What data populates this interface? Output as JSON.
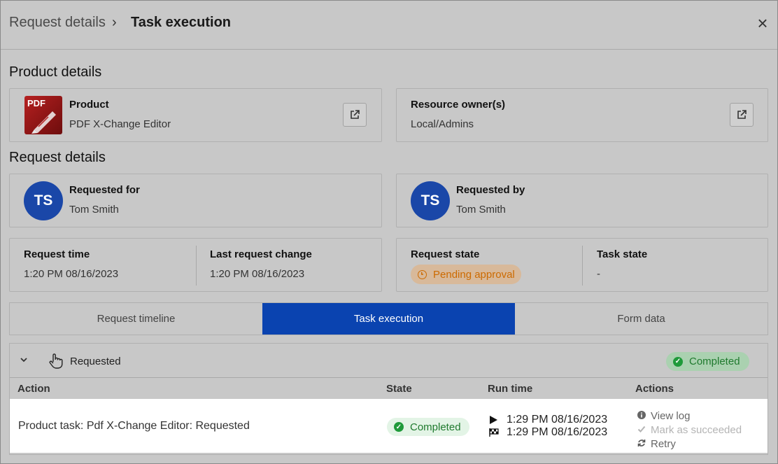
{
  "breadcrumb": {
    "parent": "Request details",
    "separator": "›",
    "current": "Task execution"
  },
  "close_label": "×",
  "product_section": {
    "title": "Product details",
    "product": {
      "label": "Product",
      "value": "PDF X-Change Editor",
      "icon_text": "PDF"
    },
    "owner": {
      "label": "Resource owner(s)",
      "value": "Local/Admins"
    }
  },
  "request_section": {
    "title": "Request details",
    "requested_for": {
      "label": "Requested for",
      "value": "Tom Smith",
      "initials": "TS"
    },
    "requested_by": {
      "label": "Requested by",
      "value": "Tom Smith",
      "initials": "TS"
    },
    "request_time": {
      "label": "Request time",
      "value": "1:20 PM 08/16/2023"
    },
    "last_change": {
      "label": "Last request change",
      "value": "1:20 PM 08/16/2023"
    },
    "request_state": {
      "label": "Request state",
      "value": "Pending approval"
    },
    "task_state": {
      "label": "Task state",
      "value": "-"
    }
  },
  "tabs": [
    {
      "label": "Request timeline",
      "active": false
    },
    {
      "label": "Task execution",
      "active": true
    },
    {
      "label": "Form data",
      "active": false
    }
  ],
  "group": {
    "label": "Requested",
    "status": "Completed"
  },
  "table": {
    "columns": [
      "Action",
      "State",
      "Run time",
      "Actions"
    ],
    "rows": [
      {
        "action": "Product task: Pdf X-Change Editor: Requested",
        "state": "Completed",
        "run_start": "1:29 PM 08/16/2023",
        "run_end": "1:29 PM 08/16/2023",
        "actions": [
          "View log",
          "Mark as succeeded",
          "Retry"
        ]
      }
    ]
  },
  "colors": {
    "accent": "#0a43b0",
    "avatar": "#1a47a8",
    "pending": "#cc6a00",
    "success": "#1f9a3a"
  }
}
